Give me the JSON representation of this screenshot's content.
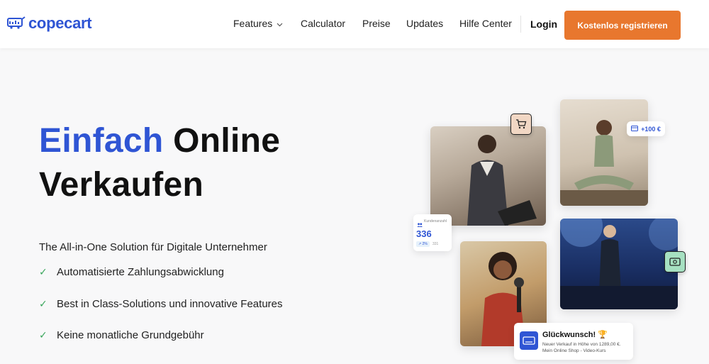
{
  "nav": {
    "logo": "copecart",
    "items": [
      {
        "label": "Features"
      },
      {
        "label": "Calculator"
      },
      {
        "label": "Preise"
      },
      {
        "label": "Updates"
      },
      {
        "label": "Hilfe Center"
      }
    ],
    "login": "Login",
    "cta": "Kostenlos registrieren"
  },
  "hero": {
    "title_accent": "Einfach",
    "title_rest": "Online",
    "title_line2": "Verkaufen",
    "subtitle": "The All-in-One Solution für Digitale Unternehmer",
    "features": [
      "Automatisierte Zahlungsabwicklung",
      "Best in Class-Solutions und innovative Features",
      "Keine monatliche Grundgebühr"
    ]
  },
  "cards": {
    "amount": "+100 €",
    "stats": {
      "label": "Kundenanzahl",
      "value": "336",
      "growth": "↗ 2%",
      "previous": "331"
    },
    "congrats": {
      "title": "Glückwunsch! 🏆",
      "line1": "Neuer Verkauf in Höhe von 1289,00 €.",
      "line2": "Mein Online Shop - Video-Kurs"
    }
  },
  "colors": {
    "brand": "#2f55d4",
    "cta": "#e8772e",
    "check": "#3aa65c"
  },
  "icons": [
    "logo-cart-icon",
    "chevron-down-icon",
    "check-icon",
    "cart-icon",
    "money-icon",
    "card-icon",
    "users-icon",
    "receipt-icon"
  ]
}
